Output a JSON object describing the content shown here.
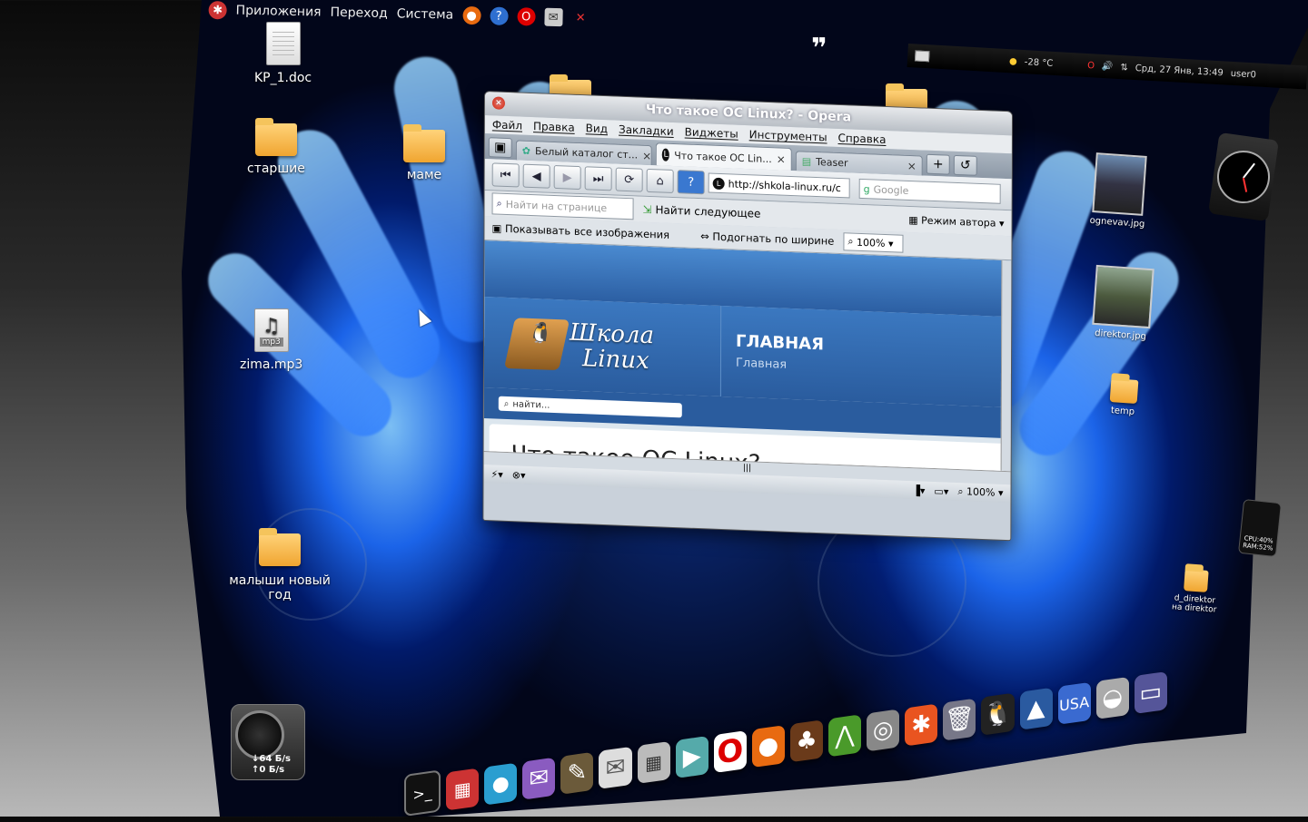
{
  "top_panel": {
    "menu_apps": "Приложения",
    "menu_go": "Переход",
    "menu_system": "Система"
  },
  "tray": {
    "weather": "-28 °C",
    "datetime": "Срд, 27 Янв, 13:49",
    "user": "user0"
  },
  "desktop_icons": {
    "kp_doc": "KP_1.doc",
    "starshie": "старшие",
    "mame": "маме",
    "zima": "zima.mp3",
    "malyshi": "малыши новый год",
    "ognev": "ognevav.jpg",
    "direktor": "direktor.jpg",
    "temp": "temp",
    "d_direktor": "d_direktor на direktor"
  },
  "browser": {
    "title": "Что такое ОС Linux? - Opera",
    "menu": [
      "Файл",
      "Правка",
      "Вид",
      "Закладки",
      "Виджеты",
      "Инструменты",
      "Справка"
    ],
    "tabs": [
      {
        "label": "Белый каталог ст..."
      },
      {
        "label": "Что такое ОС Lin..."
      },
      {
        "label": "Teaser"
      }
    ],
    "address": "http://shkola-linux.ru/c",
    "search_placeholder": "Google",
    "find_placeholder": "Найти на странице",
    "find_next": "Найти следующее",
    "author_mode": "Режим автора",
    "show_images": "Показывать все изображения",
    "fit_width": "Подогнать по ширине",
    "zoom": "100%",
    "status_zoom": "100%",
    "site": {
      "logo_line1": "Школа",
      "logo_line2": "Linux",
      "heading": "ГЛАВНАЯ",
      "subheading": "Главная",
      "search_placeholder": "найти...",
      "article_title": "Что такое ОС Linux?"
    }
  },
  "widgets": {
    "net_down": "↓64 Б/s",
    "net_up": "↑0 Б/s",
    "cpu": "CPU:40%",
    "ram": "RAM:52%"
  }
}
